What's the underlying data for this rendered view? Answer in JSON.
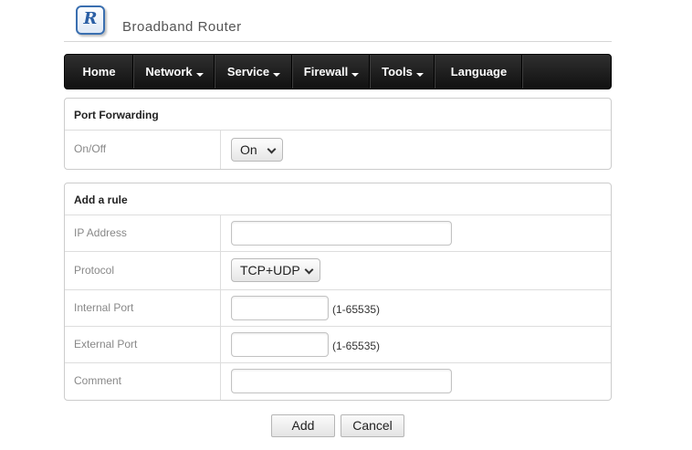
{
  "brand": {
    "logo_letter": "R",
    "title": "Broadband Router"
  },
  "nav": {
    "items": [
      {
        "label": "Home",
        "has_dropdown": false
      },
      {
        "label": "Network",
        "has_dropdown": true
      },
      {
        "label": "Service",
        "has_dropdown": true
      },
      {
        "label": "Firewall",
        "has_dropdown": true
      },
      {
        "label": "Tools",
        "has_dropdown": true
      },
      {
        "label": "Language",
        "has_dropdown": false
      }
    ]
  },
  "port_forwarding": {
    "title": "Port Forwarding",
    "onoff_label": "On/Off",
    "onoff_value": "On"
  },
  "add_rule": {
    "title": "Add a rule",
    "ip_label": "IP Address",
    "ip_value": "",
    "protocol_label": "Protocol",
    "protocol_value": "TCP+UDP",
    "internal_port_label": "Internal Port",
    "internal_port_value": "",
    "internal_port_hint": "(1-65535)",
    "external_port_label": "External Port",
    "external_port_value": "",
    "external_port_hint": "(1-65535)",
    "comment_label": "Comment",
    "comment_value": ""
  },
  "buttons": {
    "add": "Add",
    "cancel": "Cancel"
  },
  "colors": {
    "navbar": "#1e1e1e",
    "logo_accent": "#2b5fa5"
  }
}
